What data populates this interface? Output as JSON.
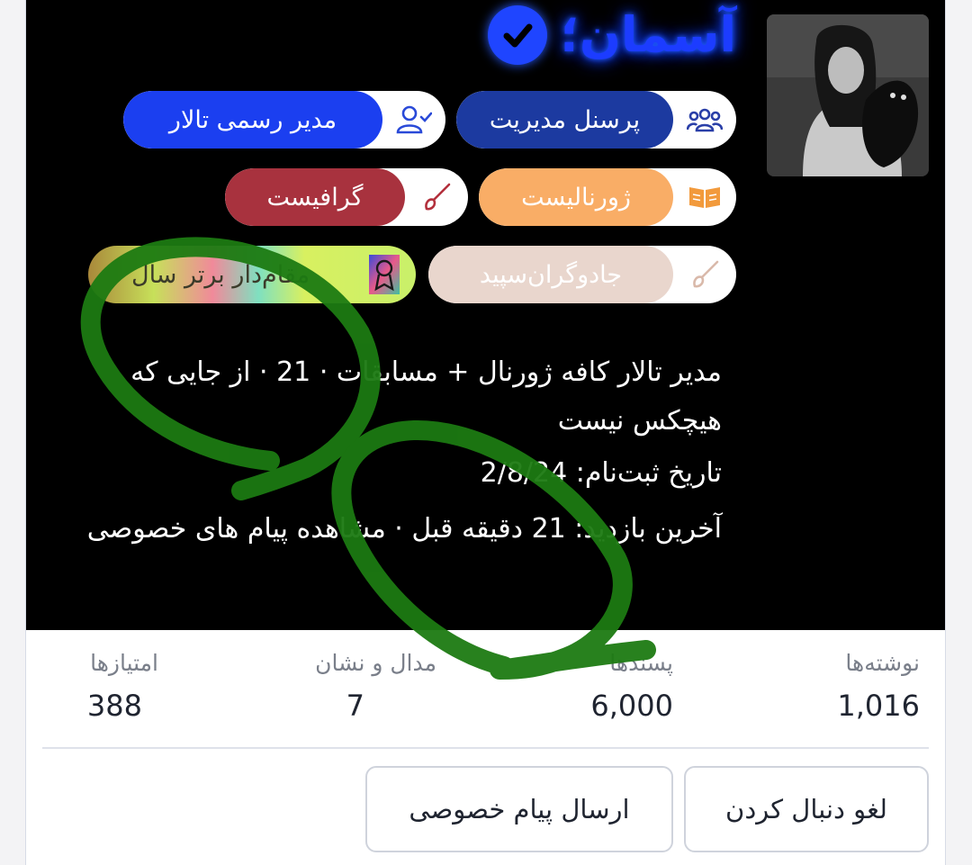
{
  "profile": {
    "username": "آسمان؛",
    "avatar_alt": "profile-photo",
    "verified_icon": "check-circle-icon"
  },
  "badges": [
    {
      "label": "پرسنل مدیریت",
      "icon": "users-icon",
      "color": "#1c3aa0",
      "text_color": "#ffffff"
    },
    {
      "label": "مدیر رسمی تالار",
      "icon": "user-check-icon",
      "color": "#1b3ff0",
      "text_color": "#ffffff"
    },
    {
      "label": "ژورنالیست",
      "icon": "book-open-icon",
      "color": "#f9ad66",
      "text_color": "#ffffff"
    },
    {
      "label": "گرافیست",
      "icon": "brush-icon",
      "color": "#a8323e",
      "text_color": "#ffffff"
    },
    {
      "label": "جادوگران‌سپید",
      "icon": "wand-icon",
      "color": "#e9d6cd",
      "text_color": "#ffffff"
    },
    {
      "label": "مقام‌دار برتر سال",
      "icon": "award-icon",
      "color": "rainbow",
      "text_color": "#3b3b2a"
    }
  ],
  "bio": {
    "description": "مدیر تالار کافه ژورنال + مسابقات · 21 · از جایی که هیچکس نیست",
    "registered": "تاریخ ثبت‌نام: 2/8/24",
    "last_seen": "آخرین بازدید: 21 دقیقه قبل · مشاهده پیام های خصوصی"
  },
  "stats": [
    {
      "label": "نوشته‌ها",
      "value": "1,016"
    },
    {
      "label": "پسندها",
      "value": "6,000"
    },
    {
      "label": "مدال و نشان",
      "value": "7"
    },
    {
      "label": "امتیازها",
      "value": "388"
    }
  ],
  "actions": {
    "unfollow_label": "لغو دنبال کردن",
    "message_label": "ارسال پیام خصوصی"
  },
  "colors": {
    "hero_background": "#000000",
    "username_glow": "#1c3cff",
    "annotation_stroke": "#1c7a12"
  }
}
